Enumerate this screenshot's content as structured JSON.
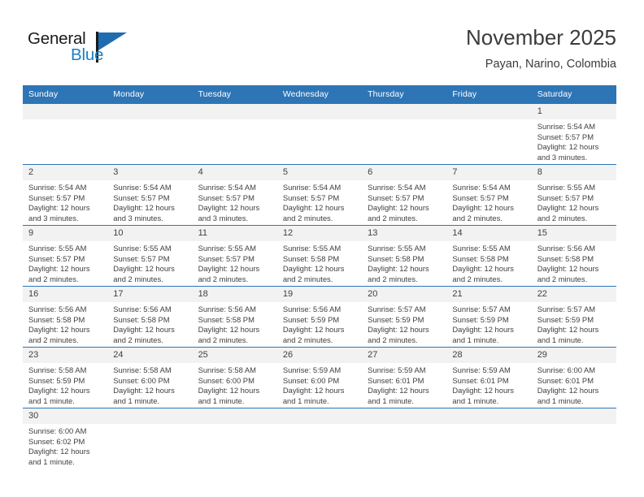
{
  "brand": {
    "name_part1": "General",
    "name_part2": "Blue",
    "flag_icon": "blue-triangle-flag"
  },
  "header": {
    "title": "November 2025",
    "subtitle": "Payan, Narino, Colombia"
  },
  "colors": {
    "header_blue": "#2E75B6",
    "brand_blue": "#1A7FC4",
    "daynum_band": "#F2F2F2",
    "text": "#404040"
  },
  "weekdays": [
    "Sunday",
    "Monday",
    "Tuesday",
    "Wednesday",
    "Thursday",
    "Friday",
    "Saturday"
  ],
  "labels": {
    "sunrise_prefix": "Sunrise:",
    "sunset_prefix": "Sunset:",
    "daylight_prefix": "Daylight:"
  },
  "weeks": [
    [
      {
        "day": "",
        "empty": true
      },
      {
        "day": "",
        "empty": true
      },
      {
        "day": "",
        "empty": true
      },
      {
        "day": "",
        "empty": true
      },
      {
        "day": "",
        "empty": true
      },
      {
        "day": "",
        "empty": true
      },
      {
        "day": "1",
        "sunrise": "Sunrise: 5:54 AM",
        "sunset": "Sunset: 5:57 PM",
        "daylight": "Daylight: 12 hours and 3 minutes."
      }
    ],
    [
      {
        "day": "2",
        "sunrise": "Sunrise: 5:54 AM",
        "sunset": "Sunset: 5:57 PM",
        "daylight": "Daylight: 12 hours and 3 minutes."
      },
      {
        "day": "3",
        "sunrise": "Sunrise: 5:54 AM",
        "sunset": "Sunset: 5:57 PM",
        "daylight": "Daylight: 12 hours and 3 minutes."
      },
      {
        "day": "4",
        "sunrise": "Sunrise: 5:54 AM",
        "sunset": "Sunset: 5:57 PM",
        "daylight": "Daylight: 12 hours and 3 minutes."
      },
      {
        "day": "5",
        "sunrise": "Sunrise: 5:54 AM",
        "sunset": "Sunset: 5:57 PM",
        "daylight": "Daylight: 12 hours and 2 minutes."
      },
      {
        "day": "6",
        "sunrise": "Sunrise: 5:54 AM",
        "sunset": "Sunset: 5:57 PM",
        "daylight": "Daylight: 12 hours and 2 minutes."
      },
      {
        "day": "7",
        "sunrise": "Sunrise: 5:54 AM",
        "sunset": "Sunset: 5:57 PM",
        "daylight": "Daylight: 12 hours and 2 minutes."
      },
      {
        "day": "8",
        "sunrise": "Sunrise: 5:55 AM",
        "sunset": "Sunset: 5:57 PM",
        "daylight": "Daylight: 12 hours and 2 minutes."
      }
    ],
    [
      {
        "day": "9",
        "sunrise": "Sunrise: 5:55 AM",
        "sunset": "Sunset: 5:57 PM",
        "daylight": "Daylight: 12 hours and 2 minutes."
      },
      {
        "day": "10",
        "sunrise": "Sunrise: 5:55 AM",
        "sunset": "Sunset: 5:57 PM",
        "daylight": "Daylight: 12 hours and 2 minutes."
      },
      {
        "day": "11",
        "sunrise": "Sunrise: 5:55 AM",
        "sunset": "Sunset: 5:57 PM",
        "daylight": "Daylight: 12 hours and 2 minutes."
      },
      {
        "day": "12",
        "sunrise": "Sunrise: 5:55 AM",
        "sunset": "Sunset: 5:58 PM",
        "daylight": "Daylight: 12 hours and 2 minutes."
      },
      {
        "day": "13",
        "sunrise": "Sunrise: 5:55 AM",
        "sunset": "Sunset: 5:58 PM",
        "daylight": "Daylight: 12 hours and 2 minutes."
      },
      {
        "day": "14",
        "sunrise": "Sunrise: 5:55 AM",
        "sunset": "Sunset: 5:58 PM",
        "daylight": "Daylight: 12 hours and 2 minutes."
      },
      {
        "day": "15",
        "sunrise": "Sunrise: 5:56 AM",
        "sunset": "Sunset: 5:58 PM",
        "daylight": "Daylight: 12 hours and 2 minutes."
      }
    ],
    [
      {
        "day": "16",
        "sunrise": "Sunrise: 5:56 AM",
        "sunset": "Sunset: 5:58 PM",
        "daylight": "Daylight: 12 hours and 2 minutes."
      },
      {
        "day": "17",
        "sunrise": "Sunrise: 5:56 AM",
        "sunset": "Sunset: 5:58 PM",
        "daylight": "Daylight: 12 hours and 2 minutes."
      },
      {
        "day": "18",
        "sunrise": "Sunrise: 5:56 AM",
        "sunset": "Sunset: 5:58 PM",
        "daylight": "Daylight: 12 hours and 2 minutes."
      },
      {
        "day": "19",
        "sunrise": "Sunrise: 5:56 AM",
        "sunset": "Sunset: 5:59 PM",
        "daylight": "Daylight: 12 hours and 2 minutes."
      },
      {
        "day": "20",
        "sunrise": "Sunrise: 5:57 AM",
        "sunset": "Sunset: 5:59 PM",
        "daylight": "Daylight: 12 hours and 2 minutes."
      },
      {
        "day": "21",
        "sunrise": "Sunrise: 5:57 AM",
        "sunset": "Sunset: 5:59 PM",
        "daylight": "Daylight: 12 hours and 1 minute."
      },
      {
        "day": "22",
        "sunrise": "Sunrise: 5:57 AM",
        "sunset": "Sunset: 5:59 PM",
        "daylight": "Daylight: 12 hours and 1 minute."
      }
    ],
    [
      {
        "day": "23",
        "sunrise": "Sunrise: 5:58 AM",
        "sunset": "Sunset: 5:59 PM",
        "daylight": "Daylight: 12 hours and 1 minute."
      },
      {
        "day": "24",
        "sunrise": "Sunrise: 5:58 AM",
        "sunset": "Sunset: 6:00 PM",
        "daylight": "Daylight: 12 hours and 1 minute."
      },
      {
        "day": "25",
        "sunrise": "Sunrise: 5:58 AM",
        "sunset": "Sunset: 6:00 PM",
        "daylight": "Daylight: 12 hours and 1 minute."
      },
      {
        "day": "26",
        "sunrise": "Sunrise: 5:59 AM",
        "sunset": "Sunset: 6:00 PM",
        "daylight": "Daylight: 12 hours and 1 minute."
      },
      {
        "day": "27",
        "sunrise": "Sunrise: 5:59 AM",
        "sunset": "Sunset: 6:01 PM",
        "daylight": "Daylight: 12 hours and 1 minute."
      },
      {
        "day": "28",
        "sunrise": "Sunrise: 5:59 AM",
        "sunset": "Sunset: 6:01 PM",
        "daylight": "Daylight: 12 hours and 1 minute."
      },
      {
        "day": "29",
        "sunrise": "Sunrise: 6:00 AM",
        "sunset": "Sunset: 6:01 PM",
        "daylight": "Daylight: 12 hours and 1 minute."
      }
    ],
    [
      {
        "day": "30",
        "sunrise": "Sunrise: 6:00 AM",
        "sunset": "Sunset: 6:02 PM",
        "daylight": "Daylight: 12 hours and 1 minute."
      },
      {
        "day": "",
        "empty": true
      },
      {
        "day": "",
        "empty": true
      },
      {
        "day": "",
        "empty": true
      },
      {
        "day": "",
        "empty": true
      },
      {
        "day": "",
        "empty": true
      },
      {
        "day": "",
        "empty": true
      }
    ]
  ]
}
